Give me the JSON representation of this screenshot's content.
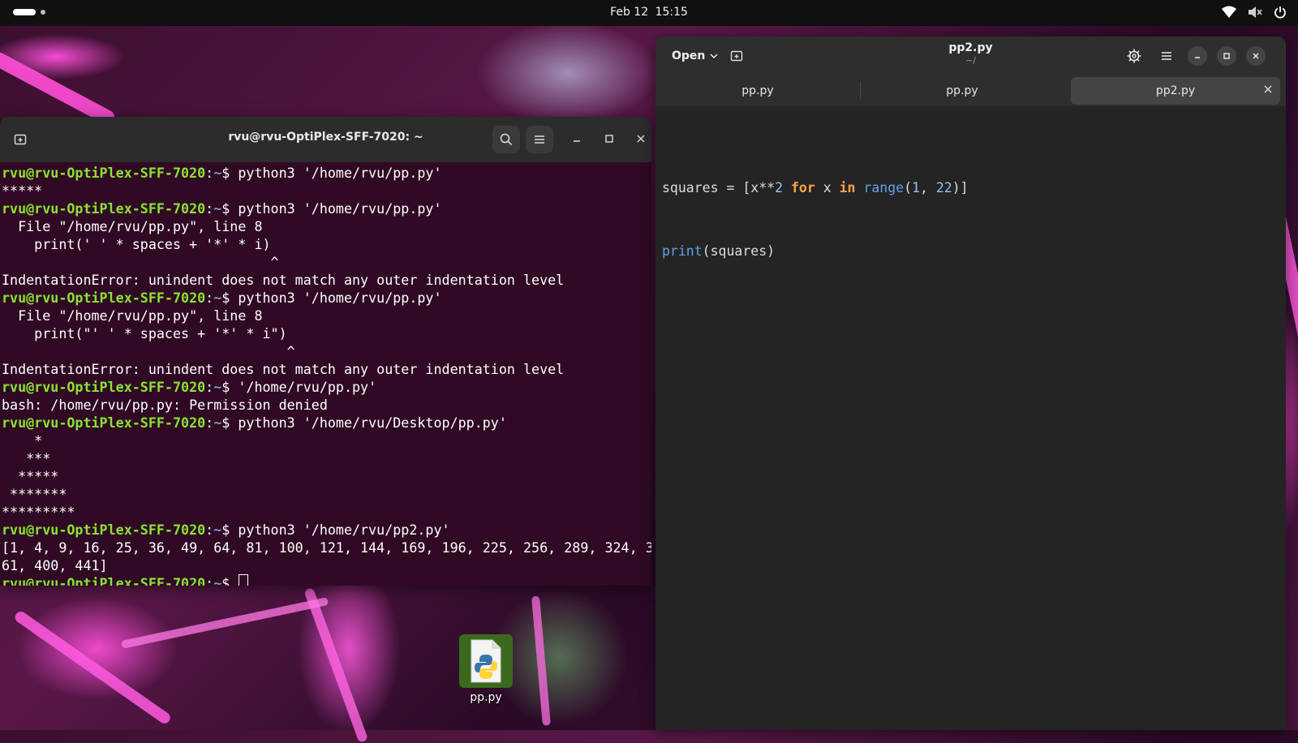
{
  "topbar": {
    "date": "Feb 12",
    "time": "15:15",
    "icons": [
      "wifi-icon",
      "volume-muted-icon",
      "power-icon"
    ]
  },
  "terminal": {
    "title": "rvu@rvu-OptiPlex-SFF-7020: ~",
    "prompt_user": "rvu@rvu-OptiPlex-SFF-7020",
    "prompt_path": "~",
    "lines": [
      {
        "type": "prompt",
        "cmd": "python3 '/home/rvu/pp.py'"
      },
      {
        "type": "out",
        "text": "*****"
      },
      {
        "type": "prompt",
        "cmd": "python3 '/home/rvu/pp.py'"
      },
      {
        "type": "out",
        "text": "  File \"/home/rvu/pp.py\", line 8"
      },
      {
        "type": "out",
        "text": "    print(' ' * spaces + '*' * i)"
      },
      {
        "type": "out",
        "text": "                                 ^"
      },
      {
        "type": "out",
        "text": "IndentationError: unindent does not match any outer indentation level"
      },
      {
        "type": "prompt",
        "cmd": "python3 '/home/rvu/pp.py'"
      },
      {
        "type": "out",
        "text": "  File \"/home/rvu/pp.py\", line 8"
      },
      {
        "type": "out",
        "text": "    print(\"' ' * spaces + '*' * i\")"
      },
      {
        "type": "out",
        "text": "                                   ^"
      },
      {
        "type": "out",
        "text": "IndentationError: unindent does not match any outer indentation level"
      },
      {
        "type": "prompt",
        "cmd": "'/home/rvu/pp.py'"
      },
      {
        "type": "out",
        "text": "bash: /home/rvu/pp.py: Permission denied"
      },
      {
        "type": "prompt",
        "cmd": "python3 '/home/rvu/Desktop/pp.py'"
      },
      {
        "type": "out",
        "text": "    *"
      },
      {
        "type": "out",
        "text": "   ***"
      },
      {
        "type": "out",
        "text": "  *****"
      },
      {
        "type": "out",
        "text": " *******"
      },
      {
        "type": "out",
        "text": "*********"
      },
      {
        "type": "prompt",
        "cmd": "python3 '/home/rvu/pp2.py'"
      },
      {
        "type": "out",
        "text": "[1, 4, 9, 16, 25, 36, 49, 64, 81, 100, 121, 144, 169, 196, 225, 256, 289, 324, 3"
      },
      {
        "type": "out",
        "text": "61, 400, 441]"
      },
      {
        "type": "prompt",
        "cmd": "",
        "cursor": true
      }
    ]
  },
  "editor": {
    "open_label": "Open",
    "title": "pp2.py",
    "subtitle": "~/",
    "tabs": [
      {
        "label": "pp.py",
        "active": false
      },
      {
        "label": "pp.py",
        "active": false
      },
      {
        "label": "pp2.py",
        "active": true
      }
    ],
    "code": {
      "line1": {
        "a": "squares = [x**",
        "n1": "2",
        "b": " ",
        "kw1": "for",
        "c": " x ",
        "kw2": "in",
        "d": " ",
        "fn": "range",
        "e": "(",
        "n2": "1",
        ", ": ", ",
        "n3": "22",
        "f": ")]"
      },
      "line2": {
        "fn": "print",
        "rest": "(squares)"
      }
    }
  },
  "desktop": {
    "icon_label": "pp.py"
  }
}
